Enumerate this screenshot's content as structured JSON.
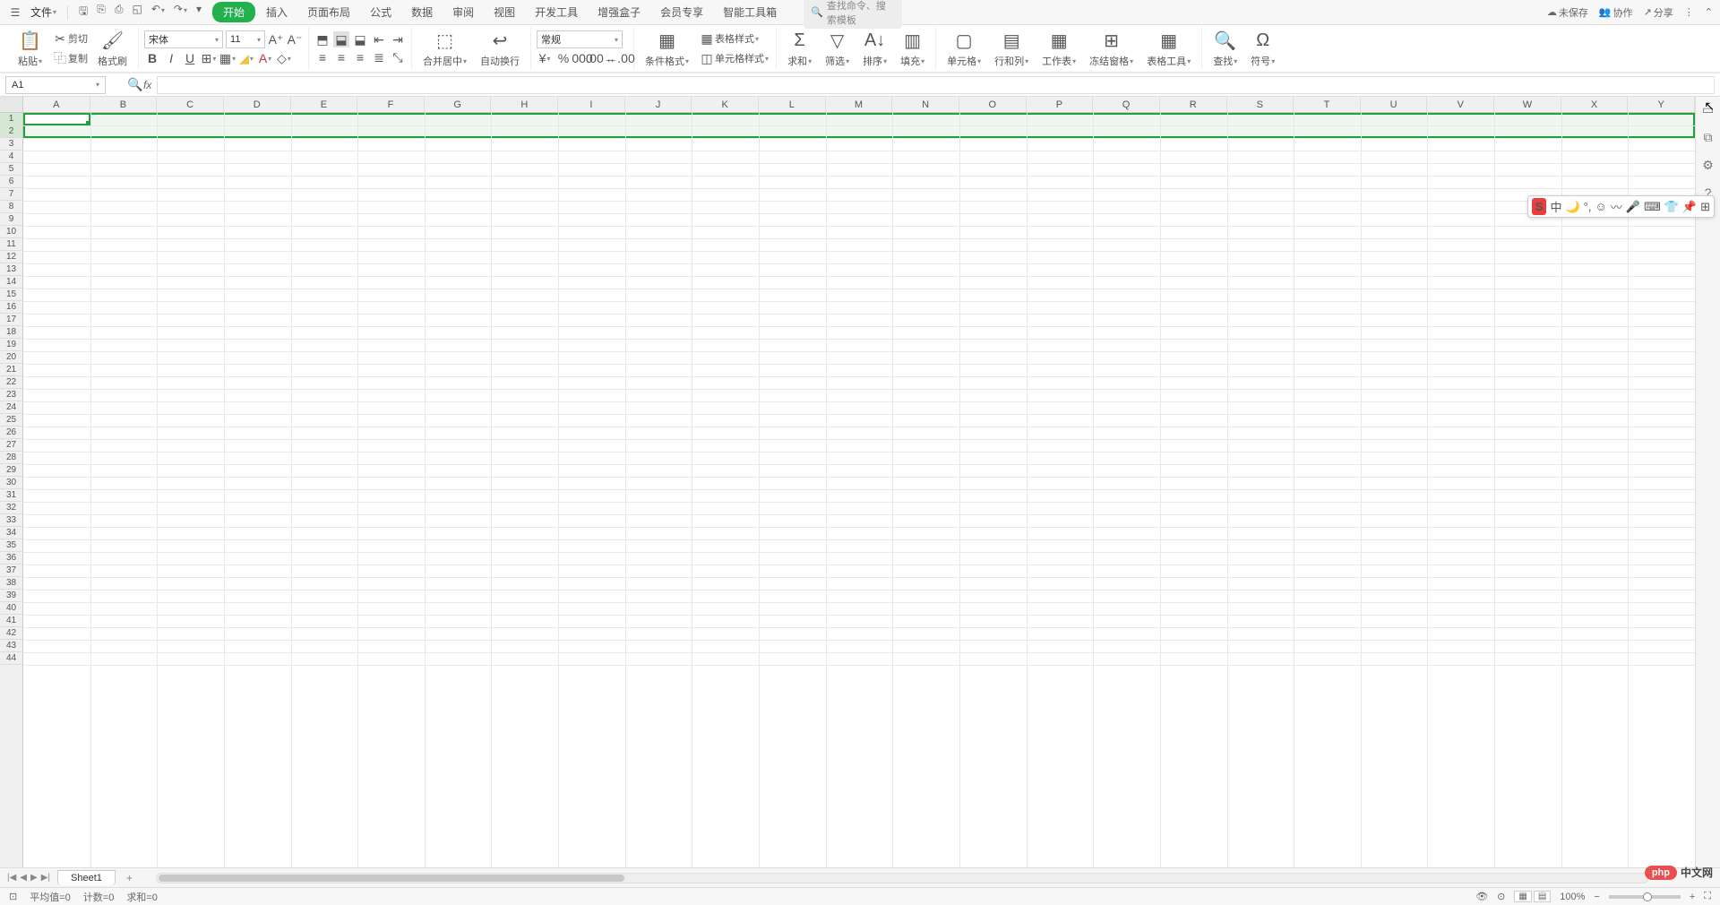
{
  "menubar": {
    "file": "文件",
    "tabs": [
      "开始",
      "插入",
      "页面布局",
      "公式",
      "数据",
      "审阅",
      "视图",
      "开发工具",
      "增强盒子",
      "会员专享",
      "智能工具箱"
    ],
    "active_tab": 0,
    "search_placeholder": "查找命令、搜索模板",
    "right": {
      "unsaved": "未保存",
      "collab": "协作",
      "share": "分享"
    }
  },
  "ribbon": {
    "paste": "粘贴",
    "cut": "剪切",
    "copy": "复制",
    "format_painter": "格式刷",
    "font_name": "宋体",
    "font_size": "11",
    "merge_center": "合并居中",
    "wrap_text": "自动换行",
    "number_format": "常规",
    "cond_format": "条件格式",
    "table_style": "表格样式",
    "cell_style": "单元格样式",
    "sum": "求和",
    "filter": "筛选",
    "sort": "排序",
    "fill": "填充",
    "cell": "单元格",
    "rowcol": "行和列",
    "worksheet": "工作表",
    "freeze": "冻结窗格",
    "table_tools": "表格工具",
    "find": "查找",
    "symbol": "符号"
  },
  "name_box": "A1",
  "columns": [
    "A",
    "B",
    "C",
    "D",
    "E",
    "F",
    "G",
    "H",
    "I",
    "J",
    "K",
    "L",
    "M",
    "N",
    "O",
    "P",
    "Q",
    "R",
    "S",
    "T",
    "U",
    "V",
    "W",
    "X",
    "Y"
  ],
  "row_count": 44,
  "selection": {
    "rows": [
      1,
      2
    ],
    "active_cell": "A1"
  },
  "sheet": {
    "name": "Sheet1"
  },
  "status": {
    "avg": "平均值=0",
    "count": "计数=0",
    "sum": "求和=0",
    "zoom": "100%"
  },
  "ime": {
    "logo": "S",
    "lang": "中"
  },
  "watermark": {
    "badge": "php",
    "text": "中文网"
  }
}
